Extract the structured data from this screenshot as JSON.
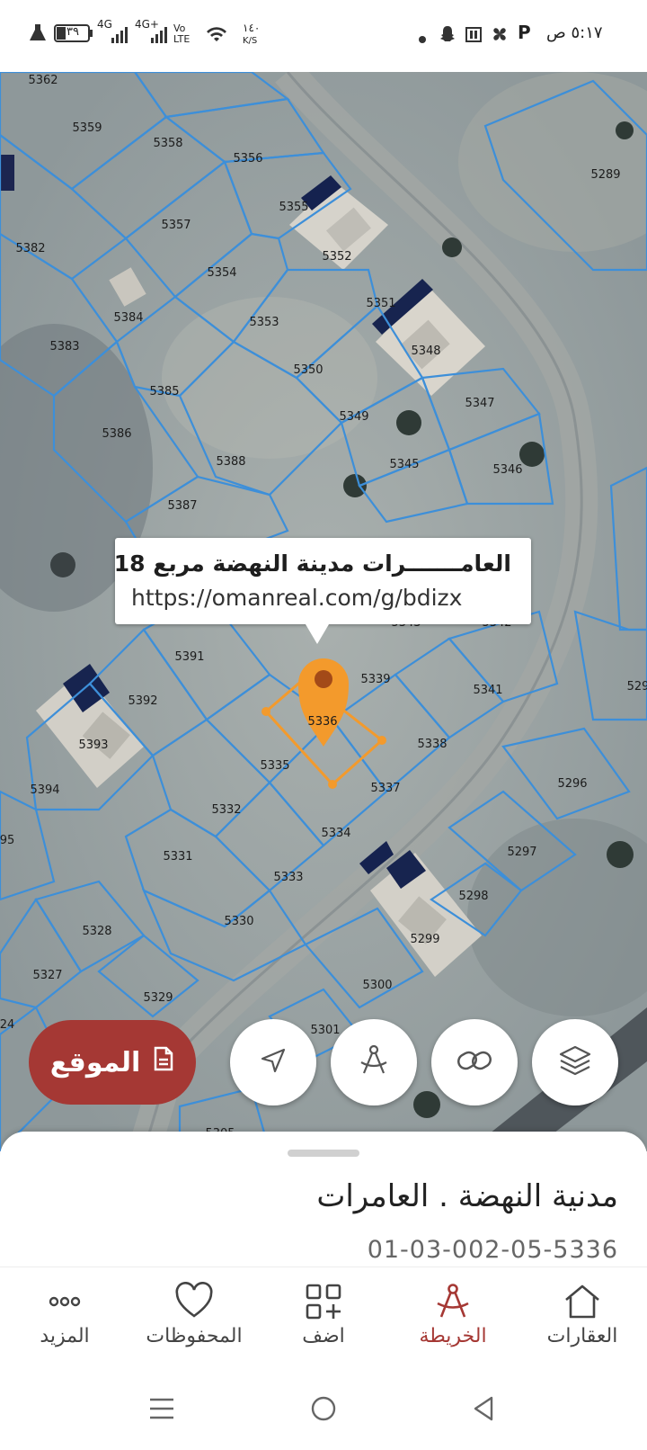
{
  "status_bar": {
    "time": "٥:١٧ ص",
    "battery": "٣٩",
    "signal_1": "4G",
    "signal_2": "4G+",
    "volte": "Vo LTE",
    "speed_value": "١٤٠",
    "speed_unit": "K/S"
  },
  "map": {
    "callout": {
      "title": "العامـــــــرات مدينة النهضة مربع 18",
      "url": "https://omanreal.com/g/bdizx"
    },
    "selected_plot": "5336",
    "plots": [
      "5362",
      "5359",
      "5358",
      "5356",
      "5355",
      "5352",
      "5357",
      "5382",
      "5354",
      "5384",
      "5353",
      "5351",
      "5383",
      "5348",
      "5350",
      "5385",
      "5349",
      "5347",
      "5386",
      "5388",
      "5345",
      "5346",
      "5387",
      "5391",
      "5339",
      "5341",
      "5392",
      "5336",
      "5393",
      "5335",
      "5338",
      "5394",
      "5337",
      "5296",
      "5332",
      "5334",
      "5331",
      "5333",
      "5297",
      "5298",
      "5330",
      "5299",
      "5328",
      "5327",
      "5300",
      "5329",
      "5301",
      "5289",
      "5343",
      "5342",
      "529",
      "95",
      "24",
      "5305"
    ],
    "accent_line": "#3d8fd9",
    "accent_pin": "#f39a2c"
  },
  "actions": {
    "location_label": "الموقع",
    "buttons": [
      "navigate-icon",
      "compass-icon",
      "link-icon",
      "layers-icon"
    ]
  },
  "sheet": {
    "title": "مدنية النهضة . العامرات",
    "code": "01-03-002-05-5336"
  },
  "bottom_nav": {
    "items": [
      {
        "label": "المزيد",
        "icon": "more-icon"
      },
      {
        "label": "المحفوظات",
        "icon": "heart-icon"
      },
      {
        "label": "اضف",
        "icon": "add-grid-icon"
      },
      {
        "label": "الخريطة",
        "icon": "map-compass-icon",
        "active": true
      },
      {
        "label": "العقارات",
        "icon": "home-icon"
      }
    ],
    "active_color": "#a53834"
  }
}
